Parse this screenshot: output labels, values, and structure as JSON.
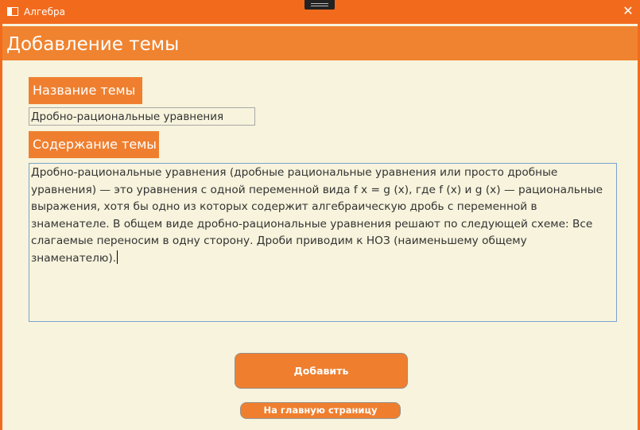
{
  "window": {
    "title": "Алгебра",
    "close_glyph": "✕",
    "icons": [
      "app-icon",
      "close-icon"
    ]
  },
  "header": {
    "title": "Добавление темы"
  },
  "form": {
    "name_label": "Название темы",
    "name_value": "Дробно-рациональные уравнения",
    "content_label": "Содержание темы",
    "content_value": "Дробно-рациональные уравнения (дробные рациональные уравнения или просто дробные уравнения) — это уравнения с одной переменной вида f x = g (x), где f (x) и g (x) — рациональные выражения, хотя бы одно из которых содержит алгебраическую дробь с переменной в знаменателе. В общем виде дробно-рациональные уравнения решают по следующей схеме: Все слагаемые переносим в одну сторону. Дроби приводим к НОЗ (наименьшему общему знаменателю)."
  },
  "actions": {
    "add_label": "Добавить",
    "home_label": "На главную страницу"
  },
  "colors": {
    "titlebar": "#f26b1d",
    "accent": "#ef7f2f",
    "background": "#f7f3dc",
    "textarea_border": "#7aa3cf"
  }
}
